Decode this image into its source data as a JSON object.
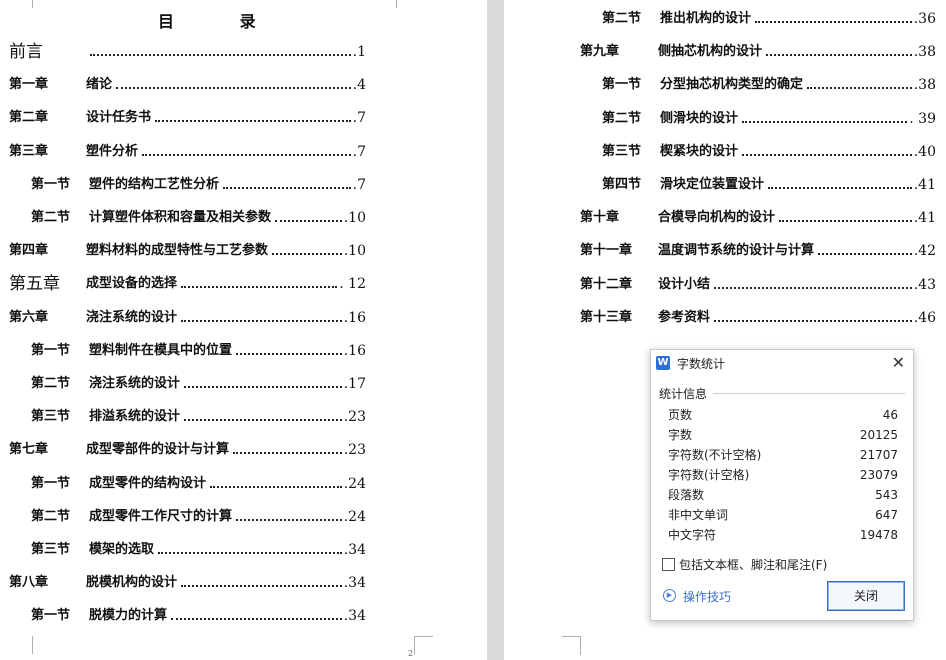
{
  "toc_title": "目 录",
  "left_entries": [
    {
      "label": "前言",
      "title": "",
      "page": ".1",
      "big": true
    },
    {
      "label": "第一章",
      "title": "绪论",
      "page": ".4"
    },
    {
      "label": "第二章",
      "title": "设计任务书",
      "page": ".7"
    },
    {
      "label": "第三章",
      "title": "塑件分析",
      "page": ".7"
    },
    {
      "label": "第一节",
      "title": "塑件的结构工艺性分析",
      "page": ".7",
      "indent": true
    },
    {
      "label": "第二节",
      "title": "计算塑件体积和容量及相关参数",
      "page": ".10",
      "indent": true
    },
    {
      "label": "第四章",
      "title": "塑料材料的成型特性与工艺参数",
      "page": ".10"
    },
    {
      "label": "第五章",
      "title": "成型设备的选择",
      "page": ". 12",
      "big": true
    },
    {
      "label": "第六章",
      "title": "浇注系统的设计",
      "page": ".16"
    },
    {
      "label": "第一节",
      "title": "塑料制件在模具中的位置",
      "page": ".16",
      "indent": true
    },
    {
      "label": "第二节",
      "title": "浇注系统的设计",
      "page": ".17",
      "indent": true
    },
    {
      "label": "第三节",
      "title": "排溢系统的设计",
      "page": ".23",
      "indent": true
    },
    {
      "label": "第七章",
      "title": "成型零部件的设计与计算",
      "page": ".23"
    },
    {
      "label": "第一节",
      "title": "成型零件的结构设计",
      "page": ".24",
      "indent": true
    },
    {
      "label": "第二节",
      "title": "成型零件工作尺寸的计算",
      "page": ".24",
      "indent": true
    },
    {
      "label": "第三节",
      "title": "模架的选取",
      "page": ".34",
      "indent": true
    },
    {
      "label": "第八章",
      "title": "脱模机构的设计",
      "page": ".34"
    },
    {
      "label": "第一节",
      "title": "脱模力的计算",
      "page": ".34",
      "indent": true
    }
  ],
  "right_entries": [
    {
      "label": "第二节",
      "title": "推出机构的设计",
      "page": ".36",
      "indent": true
    },
    {
      "label": "第九章",
      "title": "侧抽芯机构的设计",
      "page": ".38"
    },
    {
      "label": "第一节",
      "title": "分型抽芯机构类型的确定",
      "page": ".38",
      "indent": true
    },
    {
      "label": "第二节",
      "title": "侧滑块的设计",
      "page": ". 39",
      "indent": true
    },
    {
      "label": "第三节",
      "title": "楔紧块的设计",
      "page": ".40",
      "indent": true
    },
    {
      "label": "第四节",
      "title": "滑块定位装置设计",
      "page": ".41",
      "indent": true
    },
    {
      "label": "第十章",
      "title": "合模导向机构的设计",
      "page": ".41"
    },
    {
      "label": "第十一章",
      "title": "温度调节系统的设计与计算",
      "page": ".42"
    },
    {
      "label": "第十二章",
      "title": "设计小结",
      "page": ".43"
    },
    {
      "label": "第十三章",
      "title": "参考资料",
      "page": ".46"
    }
  ],
  "page_number": "2",
  "dialog": {
    "icon": "W",
    "title": "字数统计",
    "close_glyph": "✕",
    "group_title": "统计信息",
    "stats": [
      {
        "key": "页数",
        "value": "46"
      },
      {
        "key": "字数",
        "value": "20125"
      },
      {
        "key": "字符数(不计空格)",
        "value": "21707"
      },
      {
        "key": "字符数(计空格)",
        "value": "23079"
      },
      {
        "key": "段落数",
        "value": "543"
      },
      {
        "key": "非中文单词",
        "value": "647"
      },
      {
        "key": "中文字符",
        "value": "19478"
      }
    ],
    "checkbox_label": "包括文本框、脚注和尾注(F)",
    "tips_label": "操作技巧",
    "close_button": "关闭",
    "accent": "#3a6fc8"
  }
}
